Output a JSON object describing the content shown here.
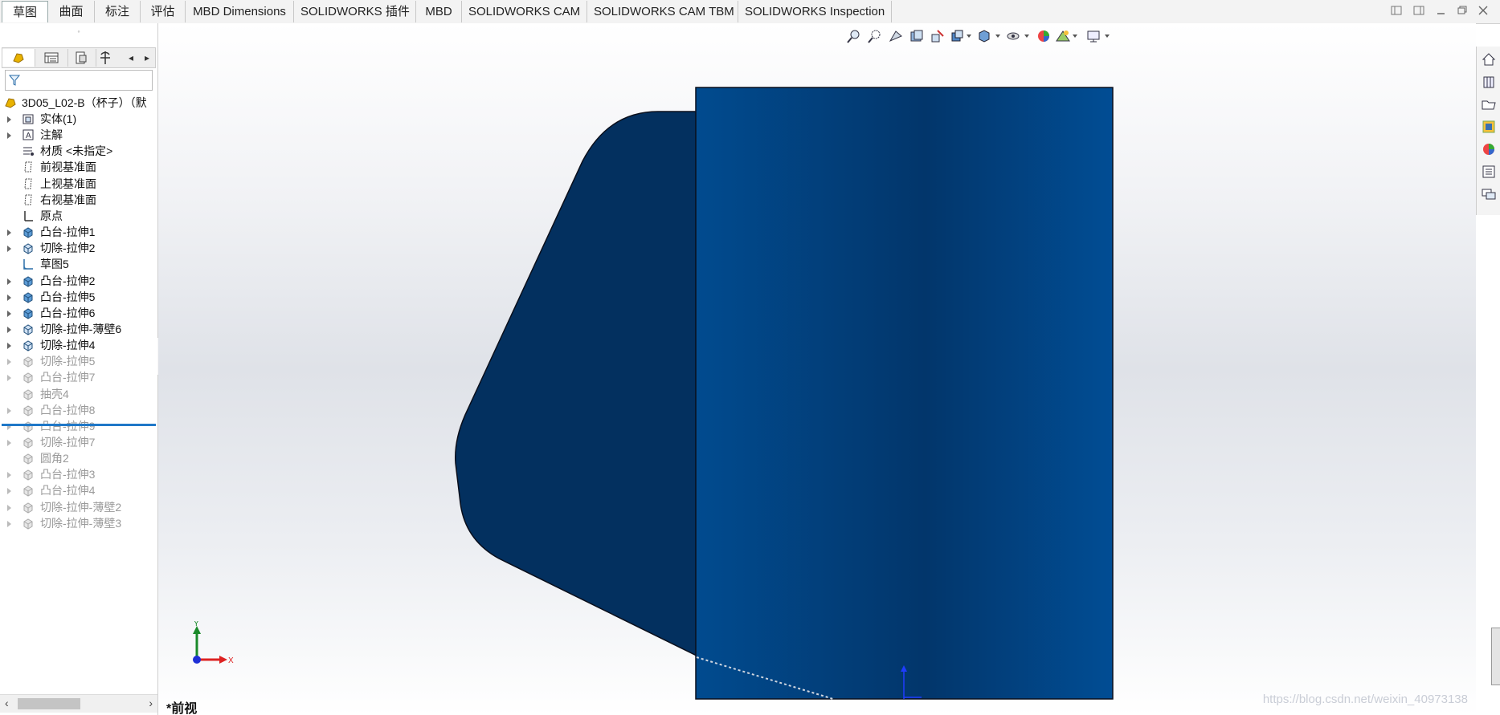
{
  "tabs": [
    {
      "label": "草图",
      "active": true
    },
    {
      "label": "曲面",
      "active": false
    },
    {
      "label": "标注",
      "active": false
    },
    {
      "label": "评估",
      "active": false
    },
    {
      "label": "MBD Dimensions",
      "active": false
    },
    {
      "label": "SOLIDWORKS 插件",
      "active": false
    },
    {
      "label": "MBD",
      "active": false
    },
    {
      "label": "SOLIDWORKS CAM",
      "active": false
    },
    {
      "label": "SOLIDWORKS CAM TBM",
      "active": false
    },
    {
      "label": "SOLIDWORKS Inspection",
      "active": false
    }
  ],
  "tree": {
    "root": "3D05_L02-B（杯子）（默",
    "items": [
      {
        "label": "实体(1)",
        "icon": "solid-bodies-icon",
        "expandable": true,
        "suppressed": false
      },
      {
        "label": "注解",
        "icon": "annotations-icon",
        "expandable": true,
        "suppressed": false
      },
      {
        "label": "材质 <未指定>",
        "icon": "material-icon",
        "expandable": false,
        "suppressed": false
      },
      {
        "label": "前视基准面",
        "icon": "plane-icon",
        "expandable": false,
        "suppressed": false
      },
      {
        "label": "上视基准面",
        "icon": "plane-icon",
        "expandable": false,
        "suppressed": false
      },
      {
        "label": "右视基准面",
        "icon": "plane-icon",
        "expandable": false,
        "suppressed": false
      },
      {
        "label": "原点",
        "icon": "origin-icon",
        "expandable": false,
        "suppressed": false
      },
      {
        "label": "凸台-拉伸1",
        "icon": "boss-extrude-icon",
        "expandable": true,
        "suppressed": false
      },
      {
        "label": "切除-拉伸2",
        "icon": "cut-extrude-icon",
        "expandable": true,
        "suppressed": false
      },
      {
        "label": "草图5",
        "icon": "sketch-icon",
        "expandable": false,
        "suppressed": false
      },
      {
        "label": "凸台-拉伸2",
        "icon": "boss-extrude-icon",
        "expandable": true,
        "suppressed": false
      },
      {
        "label": "凸台-拉伸5",
        "icon": "boss-extrude-icon",
        "expandable": true,
        "suppressed": false
      },
      {
        "label": "凸台-拉伸6",
        "icon": "boss-extrude-icon",
        "expandable": true,
        "suppressed": false
      },
      {
        "label": "切除-拉伸-薄壁6",
        "icon": "cut-extrude-icon",
        "expandable": true,
        "suppressed": false
      },
      {
        "label": "切除-拉伸4",
        "icon": "cut-extrude-icon",
        "expandable": true,
        "suppressed": false
      },
      {
        "label": "切除-拉伸5",
        "icon": "cut-extrude-icon",
        "expandable": true,
        "suppressed": true
      },
      {
        "label": "凸台-拉伸7",
        "icon": "boss-extrude-icon",
        "expandable": true,
        "suppressed": true
      },
      {
        "label": "抽壳4",
        "icon": "shell-icon",
        "expandable": false,
        "suppressed": true
      },
      {
        "label": "凸台-拉伸8",
        "icon": "boss-extrude-icon",
        "expandable": true,
        "suppressed": true
      },
      {
        "label": "凸台-拉伸9",
        "icon": "boss-extrude-icon",
        "expandable": true,
        "suppressed": true
      },
      {
        "label": "切除-拉伸7",
        "icon": "cut-extrude-icon",
        "expandable": true,
        "suppressed": true
      },
      {
        "label": "圆角2",
        "icon": "fillet-icon",
        "expandable": false,
        "suppressed": true
      },
      {
        "label": "凸台-拉伸3",
        "icon": "boss-extrude-icon",
        "expandable": true,
        "suppressed": true
      },
      {
        "label": "凸台-拉伸4",
        "icon": "boss-extrude-icon",
        "expandable": true,
        "suppressed": true
      },
      {
        "label": "切除-拉伸-薄壁2",
        "icon": "cut-extrude-icon",
        "expandable": true,
        "suppressed": true
      },
      {
        "label": "切除-拉伸-薄壁3",
        "icon": "cut-extrude-icon",
        "expandable": true,
        "suppressed": true
      }
    ]
  },
  "viewport": {
    "view_name": "*前视",
    "axis_x": "X",
    "axis_y": "Y",
    "watermark": "https://blog.csdn.net/weixin_40973138"
  },
  "colors": {
    "model_dark": "#03305f",
    "model_mid": "#024a8e",
    "accent": "#1f78c8"
  }
}
